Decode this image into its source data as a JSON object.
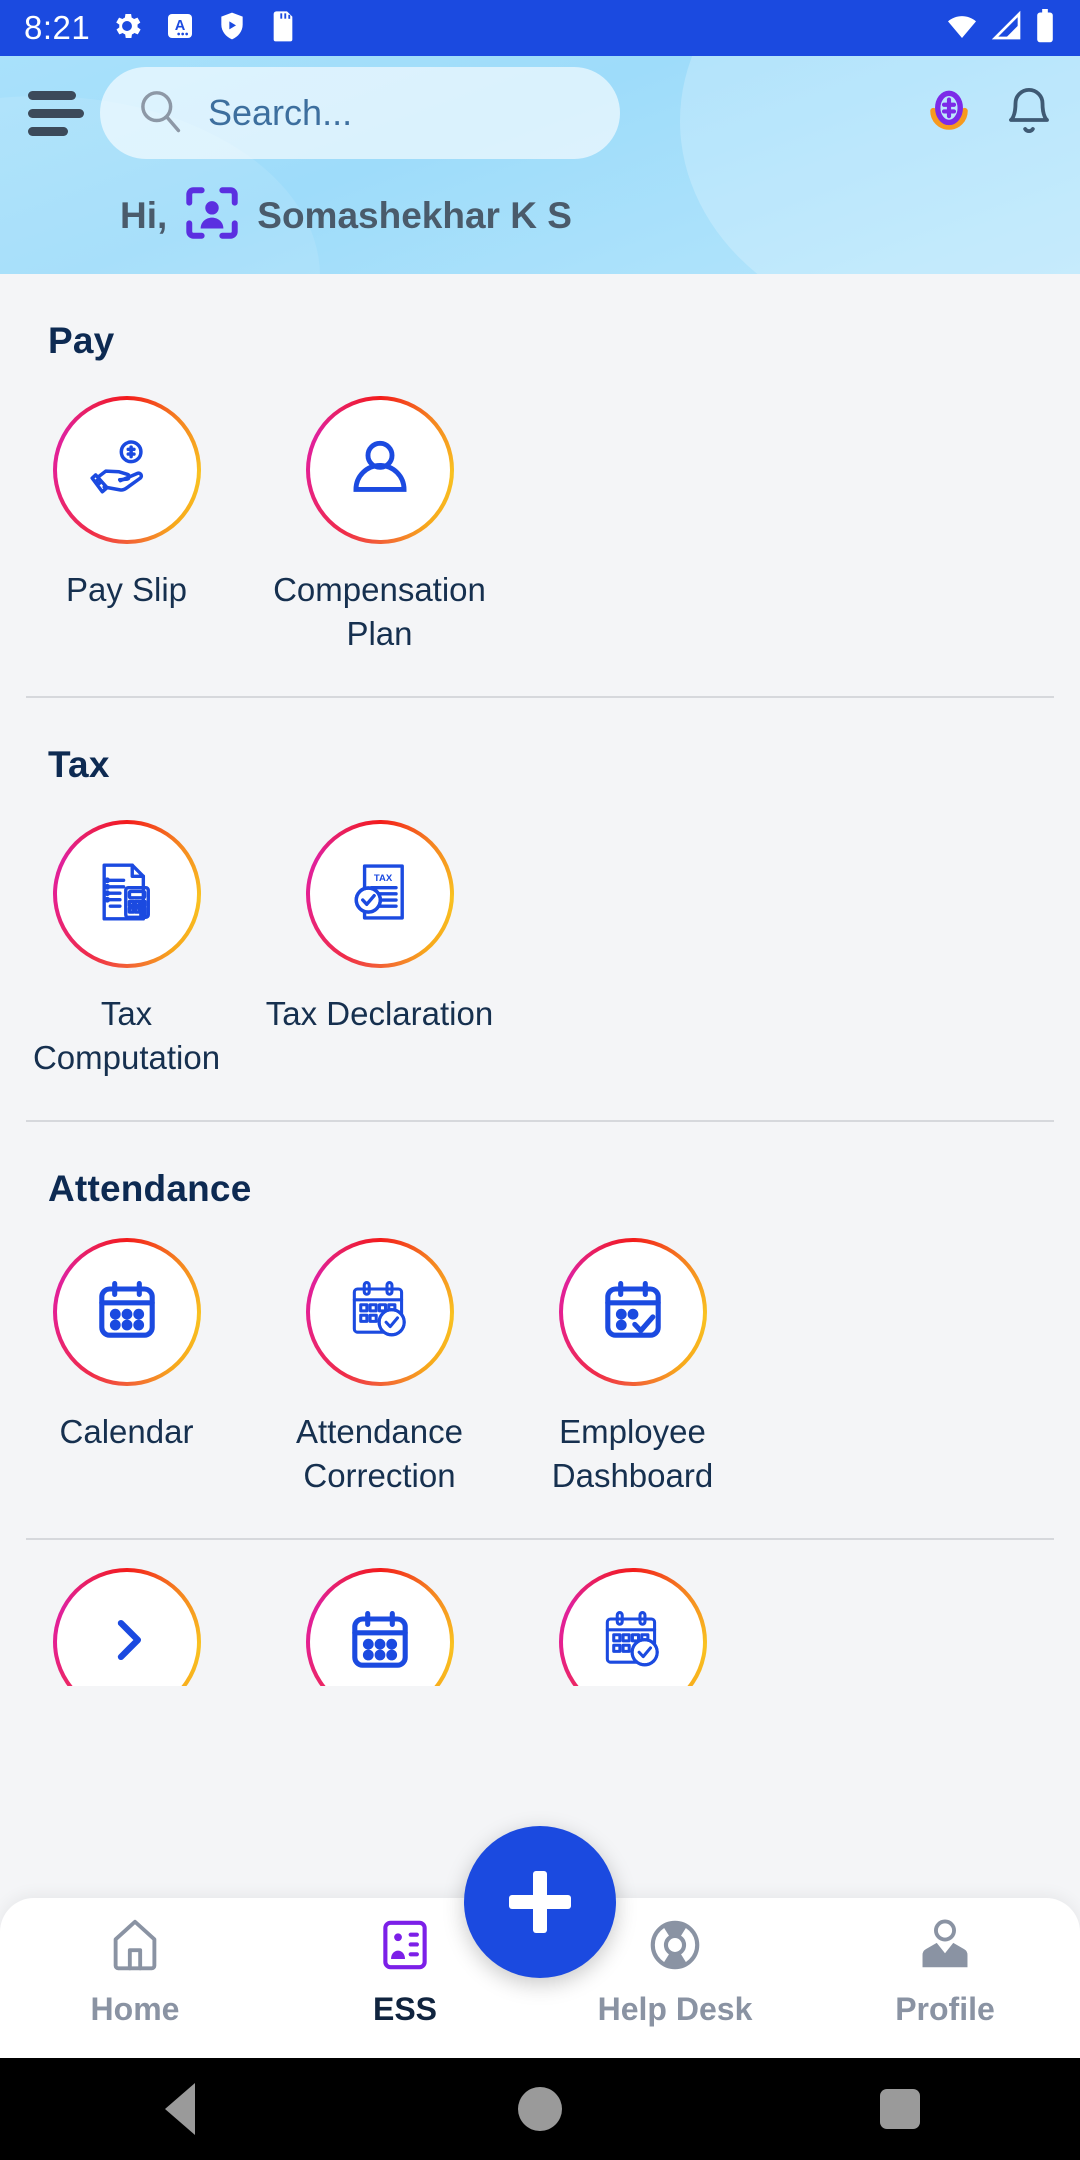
{
  "status_bar": {
    "time": "8:21",
    "left_icons": [
      "gear-icon",
      "keyboard-a-icon",
      "shield-play-icon",
      "sd-card-icon"
    ],
    "right_icons": [
      "wifi-icon",
      "signal-icon",
      "battery-icon"
    ],
    "background": "#1b4ae0"
  },
  "header": {
    "menu_icon": "hamburger-icon",
    "search": {
      "placeholder": "Search...",
      "value": "",
      "icon": "search-icon"
    },
    "actions": [
      {
        "name": "rewards-badge-icon",
        "label": ""
      },
      {
        "name": "notification-bell-icon",
        "label": ""
      }
    ],
    "greeting_prefix": "Hi,",
    "user_name": "Somashekhar K S",
    "avatar_icon": "user-scan-avatar-icon",
    "background_top": "#a9e1fb"
  },
  "colors": {
    "accent_blue": "#1b4ae0",
    "ring_gradient_from": "#e5208f",
    "ring_gradient_mid": "#f31b1b",
    "ring_gradient_to": "#f9c221",
    "section_title": "#0d2a52",
    "tile_label": "#16304f",
    "nav_inactive": "#8a93a3",
    "nav_active": "#10243f",
    "ess_purple": "#7c1fe8"
  },
  "sections": [
    {
      "title": "Pay",
      "tiles": [
        {
          "label": "Pay Slip",
          "icon": "hand-money-icon"
        },
        {
          "label": "Compensation Plan",
          "icon": "user-person-icon"
        }
      ]
    },
    {
      "title": "Tax",
      "tiles": [
        {
          "label": "Tax Computation",
          "icon": "document-calculator-icon"
        },
        {
          "label": "Tax Declaration",
          "icon": "tax-document-check-icon"
        }
      ]
    },
    {
      "title": "Attendance",
      "tiles": [
        {
          "label": "Calendar",
          "icon": "calendar-icon"
        },
        {
          "label": "Attendance Correction",
          "icon": "calendar-check-icon"
        },
        {
          "label": "Employee Dashboard",
          "icon": "calendar-check-bold-icon"
        }
      ]
    }
  ],
  "partial_row": {
    "tiles": [
      {
        "icon": "chevron-right-icon"
      },
      {
        "icon": "calendar-icon"
      },
      {
        "icon": "calendar-check-icon"
      }
    ]
  },
  "fab": {
    "icon": "plus-icon",
    "label": "",
    "color": "#1b4ae0"
  },
  "bottom_nav": {
    "items": [
      {
        "label": "Home",
        "icon": "home-icon",
        "active": false
      },
      {
        "label": "ESS",
        "icon": "id-card-icon",
        "active": true
      },
      {
        "label": "Help Desk",
        "icon": "lifebuoy-icon",
        "active": false
      },
      {
        "label": "Profile",
        "icon": "person-suit-icon",
        "active": false
      }
    ]
  },
  "android_nav": {
    "buttons": [
      {
        "name": "back-button",
        "icon": "triangle-back-icon"
      },
      {
        "name": "home-button",
        "icon": "circle-home-icon"
      },
      {
        "name": "recents-button",
        "icon": "square-recents-icon"
      }
    ]
  }
}
